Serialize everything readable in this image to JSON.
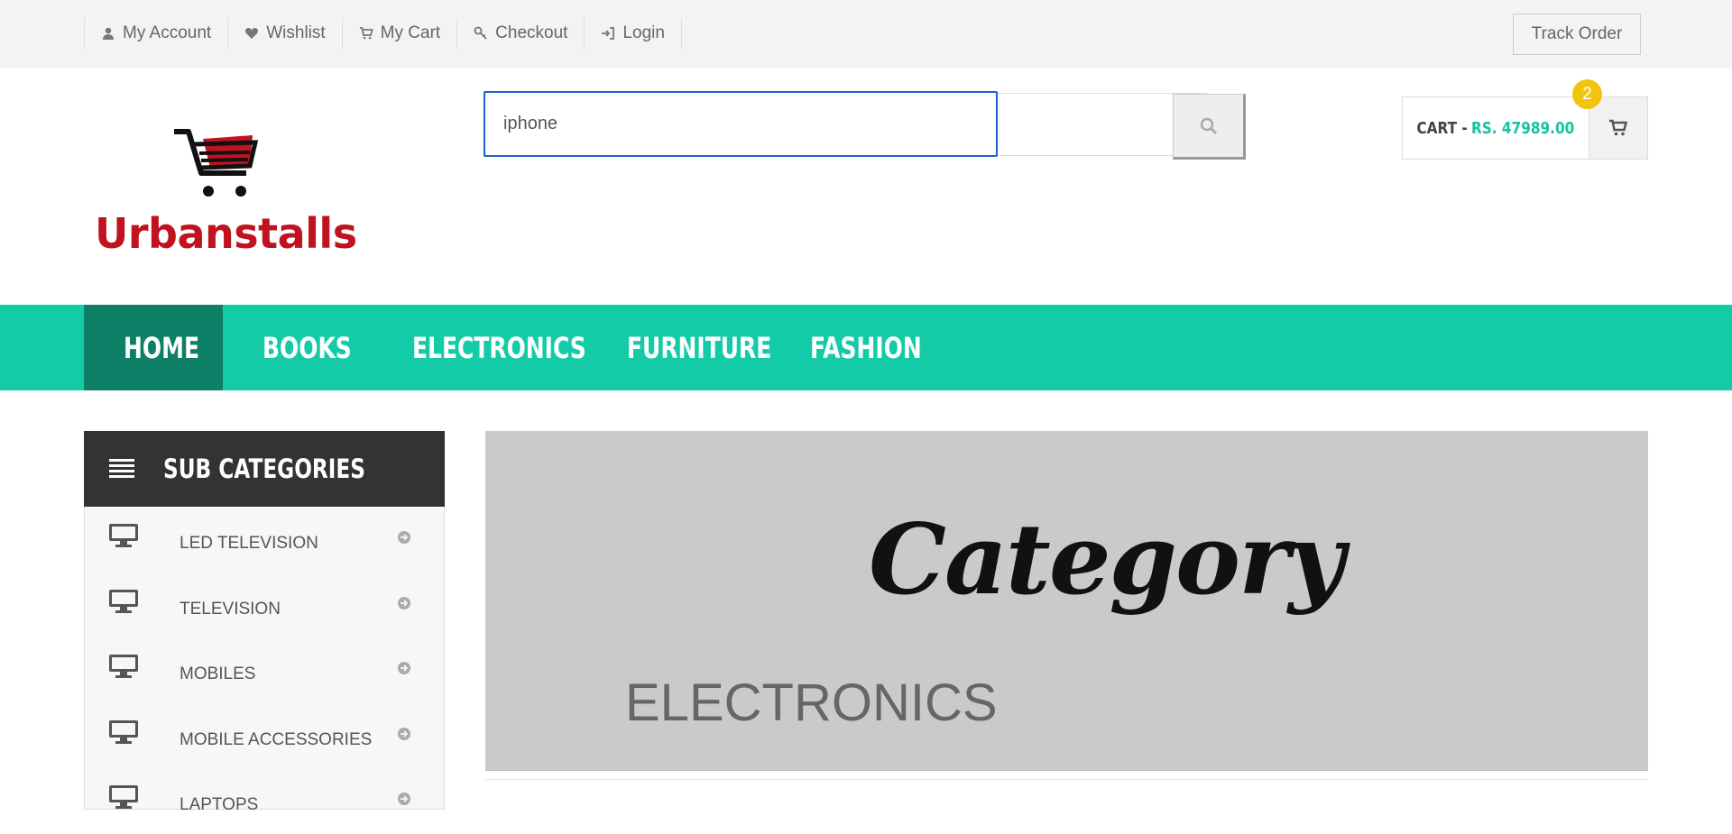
{
  "topbar": {
    "links": [
      {
        "label": "My Account",
        "icon": "user-icon"
      },
      {
        "label": "Wishlist",
        "icon": "heart-icon"
      },
      {
        "label": "My Cart",
        "icon": "cart-icon"
      },
      {
        "label": "Checkout",
        "icon": "key-icon"
      },
      {
        "label": "Login",
        "icon": "sign-in-icon"
      }
    ],
    "track_order": "Track Order"
  },
  "header": {
    "logo_text": "Urbanstalls",
    "search_value": "iphone",
    "cart_label": "CART -",
    "cart_price": "RS. 47989.00",
    "cart_count": "2"
  },
  "nav": {
    "items": [
      "HOME",
      "BOOKS",
      "ELECTRONICS",
      "FURNITURE",
      "FASHION"
    ],
    "active": "HOME"
  },
  "sidebar": {
    "title": "SUB CATEGORIES",
    "items": [
      "LED TELEVISION",
      "TELEVISION",
      "MOBILES",
      "MOBILE ACCESSORIES",
      "LAPTOPS"
    ]
  },
  "banner": {
    "script_text": "Category",
    "title": "ELECTRONICS"
  },
  "colors": {
    "accent": "#14cba8",
    "nav_active": "#0e7f67",
    "logo_red": "#c1121f",
    "badge": "#f1c40f",
    "search_focus": "#1a5fd0"
  }
}
